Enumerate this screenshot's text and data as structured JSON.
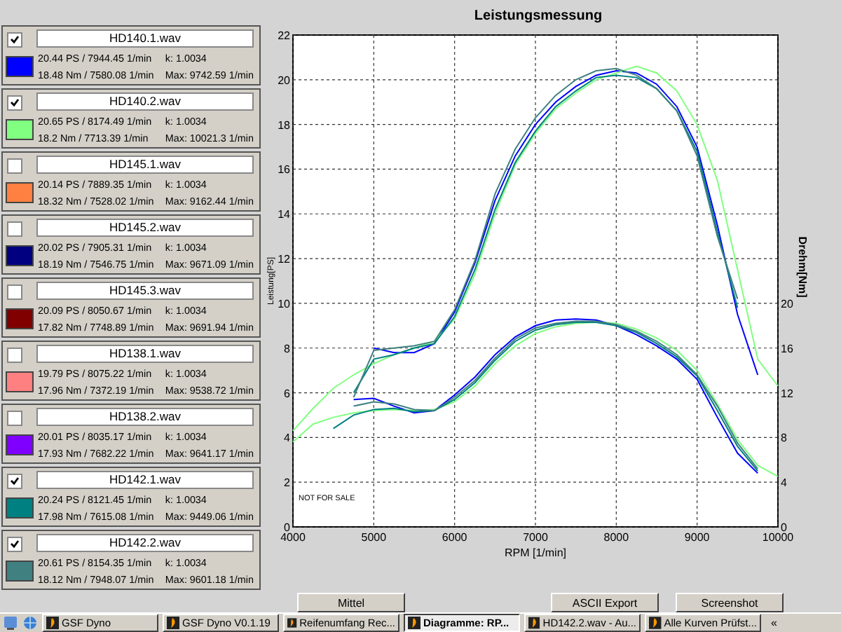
{
  "files": [
    {
      "name": "HD140.1.wav",
      "checked": true,
      "color": "#0000ff",
      "power": "20.44 PS / 7944.45 1/min",
      "torque": "18.48 Nm / 7580.08 1/min",
      "k": "k: 1.0034",
      "max": "Max: 9742.59 1/min"
    },
    {
      "name": "HD140.2.wav",
      "checked": true,
      "color": "#80ff80",
      "power": "20.65 PS / 8174.49 1/min",
      "torque": "18.2 Nm / 7713.39 1/min",
      "k": "k: 1.0034",
      "max": "Max: 10021.3 1/min"
    },
    {
      "name": "HD145.1.wav",
      "checked": false,
      "color": "#ff8040",
      "power": "20.14 PS / 7889.35 1/min",
      "torque": "18.32 Nm / 7528.02 1/min",
      "k": "k: 1.0034",
      "max": "Max: 9162.44 1/min"
    },
    {
      "name": "HD145.2.wav",
      "checked": false,
      "color": "#000080",
      "power": "20.02 PS / 7905.31 1/min",
      "torque": "18.19 Nm / 7546.75 1/min",
      "k": "k: 1.0034",
      "max": "Max: 9671.09 1/min"
    },
    {
      "name": "HD145.3.wav",
      "checked": false,
      "color": "#800000",
      "power": "20.09 PS / 8050.67 1/min",
      "torque": "17.82 Nm / 7748.89 1/min",
      "k": "k: 1.0034",
      "max": "Max: 9691.94 1/min"
    },
    {
      "name": "HD138.1.wav",
      "checked": false,
      "color": "#ff8080",
      "power": "19.79 PS / 8075.22 1/min",
      "torque": "17.96 Nm / 7372.19 1/min",
      "k": "k: 1.0034",
      "max": "Max: 9538.72 1/min"
    },
    {
      "name": "HD138.2.wav",
      "checked": false,
      "color": "#8000ff",
      "power": "20.01 PS / 8035.17 1/min",
      "torque": "17.93 Nm / 7682.22 1/min",
      "k": "k: 1.0034",
      "max": "Max: 9641.17 1/min"
    },
    {
      "name": "HD142.1.wav",
      "checked": true,
      "color": "#008080",
      "power": "20.24 PS / 8121.45 1/min",
      "torque": "17.98 Nm / 7615.08 1/min",
      "k": "k: 1.0034",
      "max": "Max: 9449.06 1/min"
    },
    {
      "name": "HD142.2.wav",
      "checked": true,
      "color": "#408080",
      "power": "20.61 PS / 8154.35 1/min",
      "torque": "18.12 Nm / 7948.07 1/min",
      "k": "k: 1.0034",
      "max": "Max: 9601.18 1/min"
    }
  ],
  "chart": {
    "chart_data": {
      "type": "line",
      "title": "Leistungsmessung",
      "xlabel": "RPM [1/min]",
      "ylabel": "Leistung[PS]",
      "y2label": "Drehm[Nm]",
      "x": [
        4000,
        4250,
        4500,
        4750,
        5000,
        5250,
        5500,
        5750,
        6000,
        6250,
        6500,
        6750,
        7000,
        7250,
        7500,
        7750,
        8000,
        8250,
        8500,
        8750,
        9000,
        9250,
        9500,
        9750,
        10000
      ],
      "xlim": [
        4000,
        10000
      ],
      "ylim": [
        0,
        22
      ],
      "y2lim": [
        0,
        44
      ],
      "xticks": [
        4000,
        5000,
        6000,
        7000,
        8000,
        9000,
        10000
      ],
      "yticks": [
        0,
        2,
        4,
        6,
        8,
        10,
        12,
        14,
        16,
        18,
        20,
        22
      ],
      "y2ticks": [
        0,
        4,
        8,
        12,
        16,
        20
      ],
      "grid": true,
      "series": [
        {
          "color": "#0000ff",
          "values": [
            null,
            null,
            null,
            null,
            8.0,
            7.8,
            7.8,
            8.2,
            9.6,
            11.8,
            14.6,
            16.6,
            18.0,
            19.0,
            19.7,
            20.2,
            20.4,
            20.3,
            19.8,
            18.8,
            17.0,
            13.5,
            9.5,
            6.8,
            null
          ]
        },
        {
          "color": "#80ff80",
          "values": [
            4.3,
            5.3,
            6.2,
            6.8,
            7.3,
            7.7,
            8.0,
            8.3,
            9.3,
            11.3,
            14.0,
            16.2,
            17.6,
            18.7,
            19.4,
            20.0,
            20.3,
            20.6,
            20.3,
            19.5,
            18.0,
            15.5,
            11.5,
            7.5,
            6.3
          ]
        },
        {
          "color": "#008080",
          "values": [
            null,
            null,
            null,
            6.0,
            7.5,
            7.7,
            8.0,
            8.2,
            9.4,
            11.5,
            14.2,
            16.3,
            17.7,
            18.8,
            19.5,
            20.1,
            20.2,
            20.1,
            19.6,
            18.6,
            16.8,
            13.2,
            9.8,
            null,
            null
          ]
        },
        {
          "color": "#408080",
          "values": [
            null,
            null,
            null,
            5.8,
            7.9,
            8.0,
            8.1,
            8.3,
            9.7,
            11.9,
            14.9,
            16.9,
            18.3,
            19.3,
            20.0,
            20.4,
            20.5,
            20.2,
            19.6,
            18.6,
            16.6,
            13.0,
            10.2,
            null,
            null
          ]
        },
        {
          "color": "#0000ff",
          "axis": "y2",
          "values": [
            null,
            null,
            null,
            11.4,
            11.5,
            10.8,
            10.2,
            10.4,
            11.8,
            13.4,
            15.4,
            17.0,
            18.0,
            18.5,
            18.6,
            18.5,
            18.0,
            17.2,
            16.2,
            15.0,
            13.2,
            9.8,
            6.6,
            4.8,
            null
          ]
        },
        {
          "color": "#80ff80",
          "axis": "y2",
          "values": [
            7.6,
            9.2,
            9.8,
            10.2,
            10.4,
            10.5,
            10.4,
            10.5,
            11.2,
            12.6,
            14.6,
            16.2,
            17.3,
            17.9,
            18.2,
            18.3,
            18.2,
            17.7,
            16.9,
            15.8,
            14.0,
            11.0,
            7.8,
            5.5,
            4.5
          ]
        },
        {
          "color": "#008080",
          "axis": "y2",
          "values": [
            null,
            null,
            8.8,
            10.0,
            10.5,
            10.6,
            10.3,
            10.4,
            11.4,
            12.9,
            14.9,
            16.6,
            17.6,
            18.1,
            18.3,
            18.3,
            18.0,
            17.4,
            16.4,
            15.2,
            13.5,
            10.4,
            7.2,
            5.0,
            null
          ]
        },
        {
          "color": "#408080",
          "axis": "y2",
          "values": [
            null,
            null,
            null,
            10.8,
            11.2,
            11.0,
            10.5,
            10.4,
            11.6,
            13.1,
            15.1,
            16.8,
            17.8,
            18.2,
            18.4,
            18.4,
            18.1,
            17.5,
            16.6,
            15.4,
            13.6,
            10.8,
            7.5,
            5.2,
            null
          ]
        }
      ],
      "annotations": [
        "NOT FOR SALE"
      ]
    }
  },
  "buttons": [
    {
      "label": "Mittel"
    },
    {
      "label": "ASCII Export"
    },
    {
      "label": "Screenshot"
    }
  ],
  "taskbar": {
    "items": [
      {
        "label": "GSF Dyno",
        "selected": false
      },
      {
        "label": "GSF Dyno V0.1.19",
        "selected": false
      },
      {
        "label": "Reifenumfang Rec...",
        "selected": false
      },
      {
        "label": "Diagramme: RP...",
        "selected": true
      },
      {
        "label": "HD142.2.wav - Au...",
        "selected": false
      },
      {
        "label": "Alle Kurven Prüfst...",
        "selected": false
      }
    ],
    "tray_toggle": "«"
  }
}
